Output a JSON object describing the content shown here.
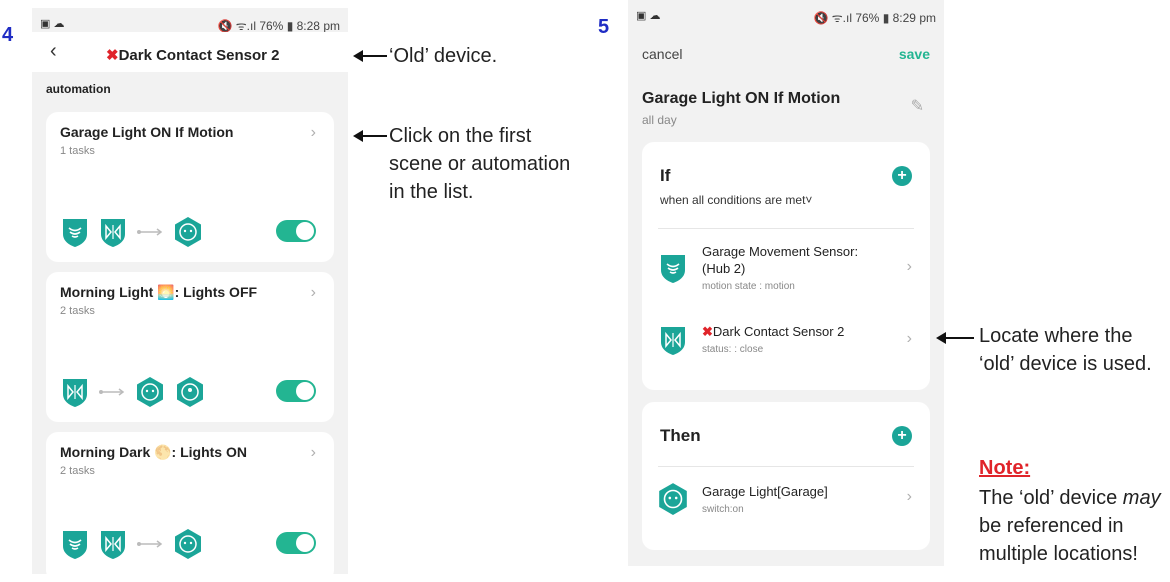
{
  "step_labels": {
    "left": "4",
    "right": "5"
  },
  "phone1": {
    "status_left": "▣ ☁",
    "status_right": "🔇 ᯤ.ıl 76% ▮ 8:28 pm",
    "header": {
      "x": "✖",
      "title": "Dark Contact Sensor 2",
      "back": "‹"
    },
    "section": "automation",
    "cards": [
      {
        "title": "Garage Light ON If Motion",
        "sub": "1 tasks",
        "chevron": "›"
      },
      {
        "title": "Morning Light 🌅: Lights OFF",
        "sub": "2 tasks",
        "chevron": "›"
      },
      {
        "title": "Morning Dark 🌕: Lights ON",
        "sub": "2 tasks",
        "chevron": "›"
      }
    ]
  },
  "phone2": {
    "status_left": "▣ ☁",
    "status_right": "🔇 ᯤ.ıl 76% ▮ 8:29 pm",
    "cancel": "cancel",
    "save": "save",
    "title": "Garage Light ON If Motion",
    "sub": "all day",
    "edit_icon": "✎",
    "if_title": "If",
    "if_sub": "when all conditions are met˅",
    "conditions": [
      {
        "title_line1": "Garage Movement Sensor:",
        "title_line2": "(Hub 2)",
        "sub": "motion state : motion",
        "chevron": "›"
      },
      {
        "x": "✖",
        "title": "Dark Contact Sensor 2",
        "sub": "status: : close",
        "chevron": "›"
      }
    ],
    "then_title": "Then",
    "actions": [
      {
        "title": "Garage Light[Garage]",
        "sub": "switch:on",
        "chevron": "›"
      }
    ],
    "plus": "+"
  },
  "annotations": {
    "old_device": "‘Old’ device.",
    "click_first_1": "Click on the first",
    "click_first_2": "scene or automation",
    "click_first_3": "in the list.",
    "locate_1": "Locate where the",
    "locate_2": "‘old’ device is used.",
    "note_title": "Note:",
    "note_1_a": "The ‘old’ device ",
    "note_1_b": "may",
    "note_2": "be referenced in",
    "note_3": "multiple locations!"
  },
  "colors": {
    "accent": "#1ba598",
    "toggle": "#23b592",
    "error": "#e0242a",
    "step": "#1f2cc4"
  }
}
